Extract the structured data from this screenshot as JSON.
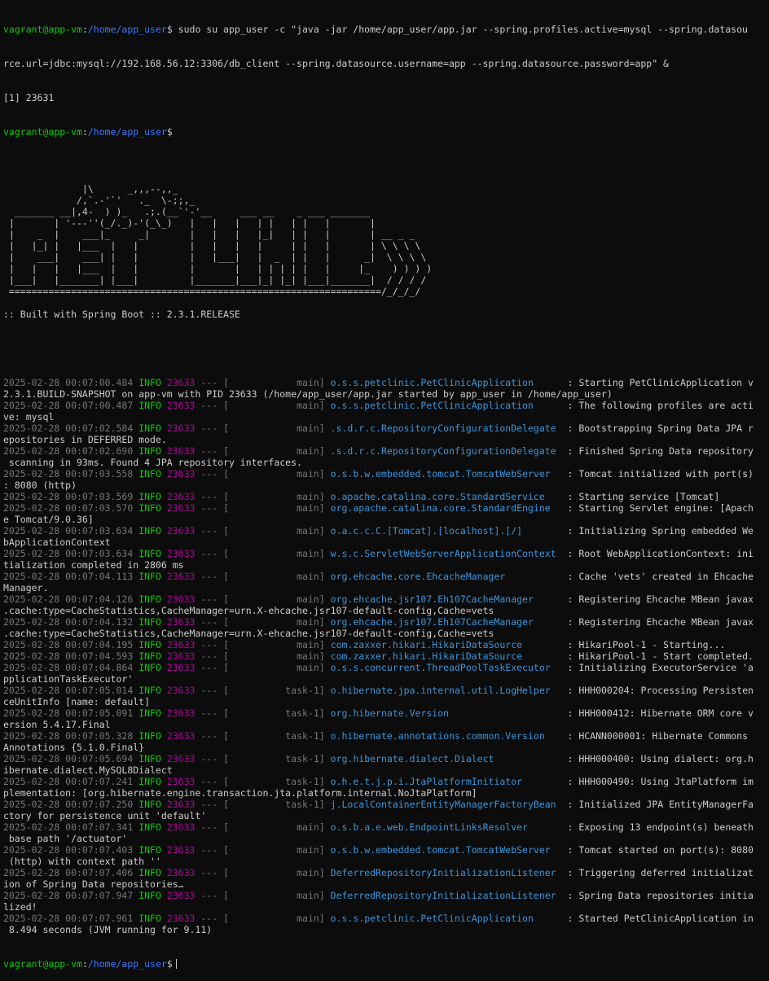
{
  "colors": {
    "background": "#0c0c0c",
    "text": "#cccccc",
    "user_host": "#16c60c",
    "path": "#3b78ff",
    "timestamp": "#767676",
    "level": "#16c60c",
    "pid": "#b4009e",
    "logger": "#3a96dd"
  },
  "prompt": {
    "user_host": "vagrant@app-vm",
    "sep": ":",
    "path": "/home/app_user",
    "symbol": "$"
  },
  "command": {
    "text_1": " sudo su app_user -c \"java -jar /home/app_user/app.jar --spring.profiles.active=mysql --spring.datasou",
    "text_2": "rce.url=jdbc:mysql://192.168.56.12:3306/db_client --spring.datasource.username=app --spring.datasource.password=app\" &",
    "job": "[1] 23631"
  },
  "banner": [
    "",
    "",
    "              |\\      _,,,--,,_",
    "             /,`.-'`'   ._  \\-;;,_",
    "  _______ __|,4-  ) )_   .;.(__`'-'__     ___ __    _ ___ _______",
    " |       | '---''(_/._)-'(_\\_)   |   |   |   | |   | |   |       |",
    " |    _  |    ___|_     _|       |   |   |   |_|   | |   |       | __ _ _",
    " |   |_| |   |___  |   |         |   |   |   |     | |   |       | \\ \\ \\ \\",
    " |    ___|    ___| |   |         |   |___|   |  _  | |   |      _|  \\ \\ \\ \\",
    " |   |   |   |___  |   |         |       |   | | | | |   |     |_    ) ) ) )",
    " |___|   |_______| |___|         |_______|___|_| |_| |___|_______|  / / / /",
    " ==================================================================/_/_/_/",
    "",
    ":: Built with Spring Boot :: 2.3.1.RELEASE",
    "",
    "",
    ""
  ],
  "logs": [
    {
      "ts": "2025-02-28 00:07:00.484",
      "level": "INFO",
      "pid": "23633",
      "sep": " --- [",
      "thread": "           main]",
      "logger": "o.s.s.petclinic.PetClinicApplication    ",
      "msg": " : Starting PetClinicApplication v",
      "cont": "2.3.1.BUILD-SNAPSHOT on app-vm with PID 23633 (/home/app_user/app.jar started by app_user in /home/app_user)"
    },
    {
      "ts": "2025-02-28 00:07:00.487",
      "level": "INFO",
      "pid": "23633",
      "sep": " --- [",
      "thread": "           main]",
      "logger": "o.s.s.petclinic.PetClinicApplication    ",
      "msg": " : The following profiles are acti",
      "cont": "ve: mysql"
    },
    {
      "ts": "2025-02-28 00:07:02.584",
      "level": "INFO",
      "pid": "23633",
      "sep": " --- [",
      "thread": "           main]",
      "logger": ".s.d.r.c.RepositoryConfigurationDelegate",
      "msg": " : Bootstrapping Spring Data JPA r",
      "cont": "epositories in DEFERRED mode."
    },
    {
      "ts": "2025-02-28 00:07:02.690",
      "level": "INFO",
      "pid": "23633",
      "sep": " --- [",
      "thread": "           main]",
      "logger": ".s.d.r.c.RepositoryConfigurationDelegate",
      "msg": " : Finished Spring Data repository",
      "cont": " scanning in 93ms. Found 4 JPA repository interfaces."
    },
    {
      "ts": "2025-02-28 00:07:03.558",
      "level": "INFO",
      "pid": "23633",
      "sep": " --- [",
      "thread": "           main]",
      "logger": "o.s.b.w.embedded.tomcat.TomcatWebServer ",
      "msg": " : Tomcat initialized with port(s)",
      "cont": ": 8080 (http)"
    },
    {
      "ts": "2025-02-28 00:07:03.569",
      "level": "INFO",
      "pid": "23633",
      "sep": " --- [",
      "thread": "           main]",
      "logger": "o.apache.catalina.core.StandardService  ",
      "msg": " : Starting service [Tomcat]",
      "cont": ""
    },
    {
      "ts": "2025-02-28 00:07:03.570",
      "level": "INFO",
      "pid": "23633",
      "sep": " --- [",
      "thread": "           main]",
      "logger": "org.apache.catalina.core.StandardEngine ",
      "msg": " : Starting Servlet engine: [Apach",
      "cont": "e Tomcat/9.0.36]"
    },
    {
      "ts": "2025-02-28 00:07:03.634",
      "level": "INFO",
      "pid": "23633",
      "sep": " --- [",
      "thread": "           main]",
      "logger": "o.a.c.c.C.[Tomcat].[localhost].[/]      ",
      "msg": " : Initializing Spring embedded We",
      "cont": "bApplicationContext"
    },
    {
      "ts": "2025-02-28 00:07:03.634",
      "level": "INFO",
      "pid": "23633",
      "sep": " --- [",
      "thread": "           main]",
      "logger": "w.s.c.ServletWebServerApplicationContext",
      "msg": " : Root WebApplicationContext: ini",
      "cont": "tialization completed in 2806 ms"
    },
    {
      "ts": "2025-02-28 00:07:04.113",
      "level": "INFO",
      "pid": "23633",
      "sep": " --- [",
      "thread": "           main]",
      "logger": "org.ehcache.core.EhcacheManager         ",
      "msg": " : Cache 'vets' created in Ehcache",
      "cont": "Manager."
    },
    {
      "ts": "2025-02-28 00:07:04.126",
      "level": "INFO",
      "pid": "23633",
      "sep": " --- [",
      "thread": "           main]",
      "logger": "org.ehcache.jsr107.Eh107CacheManager    ",
      "msg": " : Registering Ehcache MBean javax",
      "cont": ".cache:type=CacheStatistics,CacheManager=urn.X-ehcache.jsr107-default-config,Cache=vets"
    },
    {
      "ts": "2025-02-28 00:07:04.132",
      "level": "INFO",
      "pid": "23633",
      "sep": " --- [",
      "thread": "           main]",
      "logger": "org.ehcache.jsr107.Eh107CacheManager    ",
      "msg": " : Registering Ehcache MBean javax",
      "cont": ".cache:type=CacheStatistics,CacheManager=urn.X-ehcache.jsr107-default-config,Cache=vets"
    },
    {
      "ts": "2025-02-28 00:07:04.195",
      "level": "INFO",
      "pid": "23633",
      "sep": " --- [",
      "thread": "           main]",
      "logger": "com.zaxxer.hikari.HikariDataSource      ",
      "msg": " : HikariPool-1 - Starting...",
      "cont": ""
    },
    {
      "ts": "2025-02-28 00:07:04.593",
      "level": "INFO",
      "pid": "23633",
      "sep": " --- [",
      "thread": "           main]",
      "logger": "com.zaxxer.hikari.HikariDataSource      ",
      "msg": " : HikariPool-1 - Start completed.",
      "cont": ""
    },
    {
      "ts": "2025-02-28 00:07:04.864",
      "level": "INFO",
      "pid": "23633",
      "sep": " --- [",
      "thread": "           main]",
      "logger": "o.s.s.concurrent.ThreadPoolTaskExecutor ",
      "msg": " : Initializing ExecutorService 'a",
      "cont": "pplicationTaskExecutor'"
    },
    {
      "ts": "2025-02-28 00:07:05.014",
      "level": "INFO",
      "pid": "23633",
      "sep": " --- [",
      "thread": "         task-1]",
      "logger": "o.hibernate.jpa.internal.util.LogHelper ",
      "msg": " : HHH000204: Processing Persisten",
      "cont": "ceUnitInfo [name: default]"
    },
    {
      "ts": "2025-02-28 00:07:05.091",
      "level": "INFO",
      "pid": "23633",
      "sep": " --- [",
      "thread": "         task-1]",
      "logger": "org.hibernate.Version                   ",
      "msg": " : HHH000412: Hibernate ORM core v",
      "cont": "ersion 5.4.17.Final"
    },
    {
      "ts": "2025-02-28 00:07:05.328",
      "level": "INFO",
      "pid": "23633",
      "sep": " --- [",
      "thread": "         task-1]",
      "logger": "o.hibernate.annotations.common.Version  ",
      "msg": " : HCANN000001: Hibernate Commons ",
      "cont": "Annotations {5.1.0.Final}"
    },
    {
      "ts": "2025-02-28 00:07:05.694",
      "level": "INFO",
      "pid": "23633",
      "sep": " --- [",
      "thread": "         task-1]",
      "logger": "org.hibernate.dialect.Dialect           ",
      "msg": " : HHH000400: Using dialect: org.h",
      "cont": "ibernate.dialect.MySQL8Dialect"
    },
    {
      "ts": "2025-02-28 00:07:07.241",
      "level": "INFO",
      "pid": "23633",
      "sep": " --- [",
      "thread": "         task-1]",
      "logger": "o.h.e.t.j.p.i.JtaPlatformInitiator      ",
      "msg": " : HHH000490: Using JtaPlatform im",
      "cont": "plementation: [org.hibernate.engine.transaction.jta.platform.internal.NoJtaPlatform]"
    },
    {
      "ts": "2025-02-28 00:07:07.250",
      "level": "INFO",
      "pid": "23633",
      "sep": " --- [",
      "thread": "         task-1]",
      "logger": "j.LocalContainerEntityManagerFactoryBean",
      "msg": " : Initialized JPA EntityManagerFa",
      "cont": "ctory for persistence unit 'default'"
    },
    {
      "ts": "2025-02-28 00:07:07.341",
      "level": "INFO",
      "pid": "23633",
      "sep": " --- [",
      "thread": "           main]",
      "logger": "o.s.b.a.e.web.EndpointLinksResolver     ",
      "msg": " : Exposing 13 endpoint(s) beneath",
      "cont": " base path '/actuator'"
    },
    {
      "ts": "2025-02-28 00:07:07.403",
      "level": "INFO",
      "pid": "23633",
      "sep": " --- [",
      "thread": "           main]",
      "logger": "o.s.b.w.embedded.tomcat.TomcatWebServer ",
      "msg": " : Tomcat started on port(s): 8080",
      "cont": " (http) with context path ''"
    },
    {
      "ts": "2025-02-28 00:07:07.406",
      "level": "INFO",
      "pid": "23633",
      "sep": " --- [",
      "thread": "           main]",
      "logger": "DeferredRepositoryInitializationListener",
      "msg": " : Triggering deferred initializat",
      "cont": "ion of Spring Data repositories…"
    },
    {
      "ts": "2025-02-28 00:07:07.947",
      "level": "INFO",
      "pid": "23633",
      "sep": " --- [",
      "thread": "           main]",
      "logger": "DeferredRepositoryInitializationListener",
      "msg": " : Spring Data repositories initia",
      "cont": "lized!"
    },
    {
      "ts": "2025-02-28 00:07:07.961",
      "level": "INFO",
      "pid": "23633",
      "sep": " --- [",
      "thread": "           main]",
      "logger": "o.s.s.petclinic.PetClinicApplication    ",
      "msg": " : Started PetClinicApplication in",
      "cont": " 8.494 seconds (JVM running for 9.11)"
    }
  ]
}
